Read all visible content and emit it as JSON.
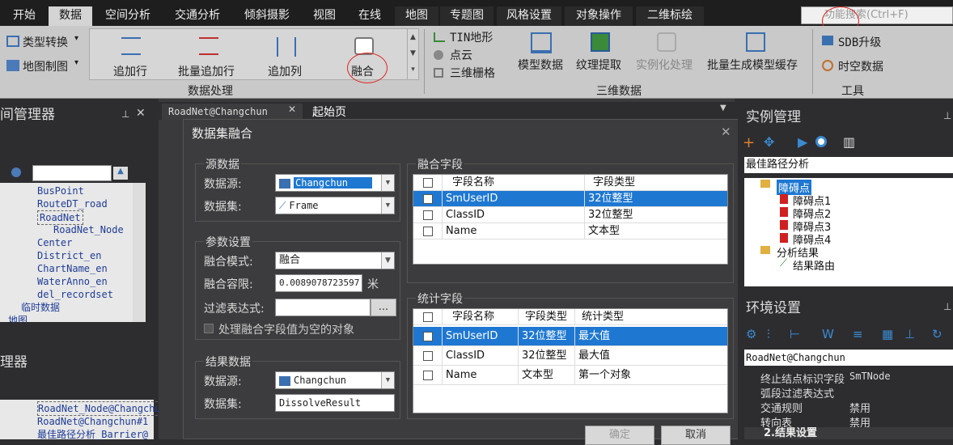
{
  "menu": {
    "tabs": [
      "开始",
      "数据",
      "空间分析",
      "交通分析",
      "倾斜摄影",
      "视图",
      "在线",
      "地图",
      "专题图",
      "风格设置",
      "对象操作",
      "二维标绘"
    ],
    "search_placeholder": "功能搜索(Ctrl+F)"
  },
  "ribbon": {
    "type_convert": "类型转换",
    "map_making": "地图制图",
    "add_row": "追加行",
    "batch_add_row": "批量追加行",
    "add_column": "追加列",
    "dissolve": "融合",
    "group_data_processing": "数据处理",
    "tin_terrain": "TIN地形",
    "point_cloud": "点云",
    "raster_3d": "三维栅格",
    "model_data": "模型数据",
    "texture_extract": "纹理提取",
    "instancing": "实例化处理",
    "batch_model_cache": "批量生成模型缓存",
    "group_3d_data": "三维数据",
    "sdb_upgrade": "SDB升级",
    "spatiotemporal": "时空数据",
    "group_tools": "工具"
  },
  "left": {
    "workspace_title": "间管理器",
    "tree_items": [
      "BusPoint",
      "RouteDT_road",
      "RoadNet",
      "RoadNet_Node",
      "Center",
      "District_en",
      "ChartName_en",
      "WaterAnno_en",
      "del_recordset",
      "临时数据",
      "地图"
    ],
    "layer_title": "理器",
    "layer_items": [
      "RoadNet_Node@Changchu",
      "RoadNet@Changchun#1",
      "最佳路径分析_Barrier@"
    ]
  },
  "doc_tabs": {
    "tab1": "RoadNet@Changchun",
    "tab2": "起始页"
  },
  "dialog": {
    "title": "数据集融合",
    "source_group": "源数据",
    "datasource_label": "数据源:",
    "datasource_value": "Changchun",
    "dataset_label": "数据集:",
    "dataset_value": "Frame",
    "param_group": "参数设置",
    "mode_label": "融合模式:",
    "mode_value": "融合",
    "tolerance_label": "融合容限:",
    "tolerance_value": "0.0089078723597",
    "tolerance_unit": "米",
    "filter_label": "过滤表达式:",
    "filter_btn": "...",
    "null_check": "处理融合字段值为空的对象",
    "result_group": "结果数据",
    "result_ds_label": "数据源:",
    "result_ds_value": "Changchun",
    "result_set_label": "数据集:",
    "result_set_value": "DissolveResult",
    "fuse_fields_group": "融合字段",
    "fuse_headers": [
      "字段名称",
      "字段类型"
    ],
    "fuse_rows": [
      [
        "SmUserID",
        "32位整型"
      ],
      [
        "ClassID",
        "32位整型"
      ],
      [
        "Name",
        "文本型"
      ]
    ],
    "stat_group": "统计字段",
    "stat_headers": [
      "字段名称",
      "字段类型",
      "统计类型"
    ],
    "stat_rows": [
      [
        "SmUserID",
        "32位整型",
        "最大值"
      ],
      [
        "ClassID",
        "32位整型",
        "最大值"
      ],
      [
        "Name",
        "文本型",
        "第一个对象"
      ]
    ],
    "ok": "确定",
    "cancel": "取消"
  },
  "right": {
    "instance_title": "实例管理",
    "analysis_select": "最佳路径分析",
    "tree": [
      "障碍点",
      "障碍点1",
      "障碍点2",
      "障碍点3",
      "障碍点4",
      "分析结果",
      "结果路由"
    ],
    "env_title": "环境设置",
    "env_select": "RoadNet@Changchun",
    "props": [
      [
        "终止结点标识字段",
        "SmTNode"
      ],
      [
        "弧段过滤表达式",
        ""
      ],
      [
        "交通规则",
        "禁用"
      ],
      [
        "转向表",
        "禁用"
      ]
    ],
    "section": "2.结果设置"
  }
}
